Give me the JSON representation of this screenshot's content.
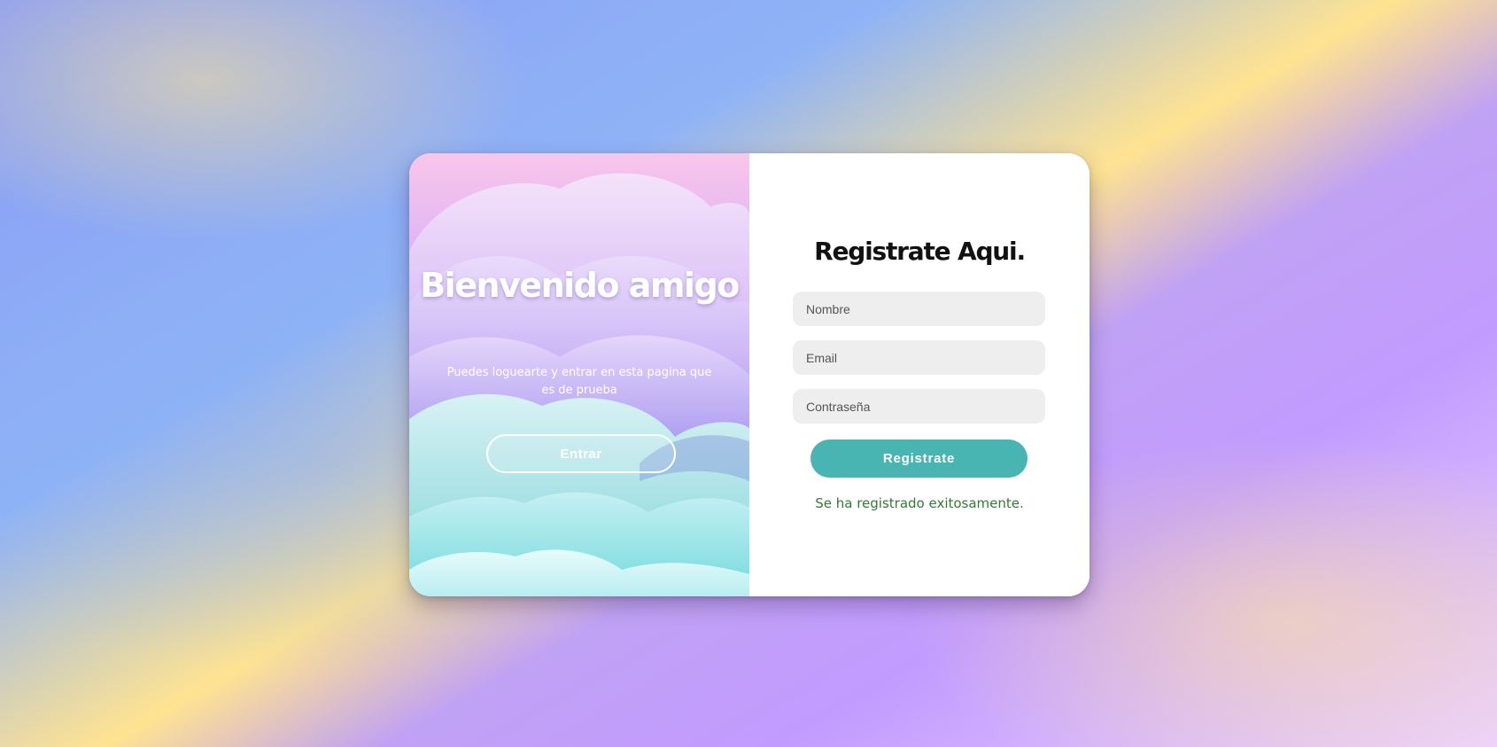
{
  "welcome": {
    "title": "Bienvenido amigo",
    "subtitle": "Puedes loguearte y entrar en esta pagina que es de prueba",
    "enter_label": "Entrar"
  },
  "register_form": {
    "title": "Registrate Aqui.",
    "name_placeholder": "Nombre",
    "email_placeholder": "Email",
    "password_placeholder": "Contraseña",
    "submit_label": "Registrate",
    "success_message": "Se ha registrado exitosamente."
  },
  "colors": {
    "accent": "#49b5b3",
    "success": "#2e7d32",
    "field_background": "#eeeeee"
  }
}
